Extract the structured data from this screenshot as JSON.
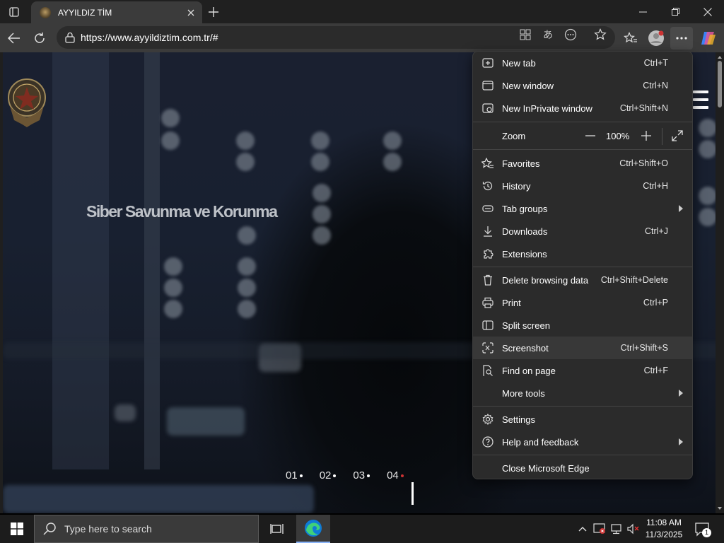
{
  "tab": {
    "title": "AYYILDIZ TİM"
  },
  "address": {
    "url": "https://www.ayyildiztim.com.tr/#"
  },
  "page": {
    "hero_text": "Siber Savunma ve Korunma",
    "slides": [
      "01",
      "02",
      "03",
      "04"
    ],
    "active_slide": "04"
  },
  "menu": {
    "items_top": [
      {
        "label": "New tab",
        "shortcut": "Ctrl+T",
        "icon": "new-tab-icon"
      },
      {
        "label": "New window",
        "shortcut": "Ctrl+N",
        "icon": "new-window-icon"
      },
      {
        "label": "New InPrivate window",
        "shortcut": "Ctrl+Shift+N",
        "icon": "inprivate-icon"
      }
    ],
    "zoom": {
      "label": "Zoom",
      "value": "100%"
    },
    "items_mid": [
      {
        "label": "Favorites",
        "shortcut": "Ctrl+Shift+O",
        "icon": "favorites-icon"
      },
      {
        "label": "History",
        "shortcut": "Ctrl+H",
        "icon": "history-icon"
      },
      {
        "label": "Tab groups",
        "shortcut": "",
        "icon": "tab-groups-icon",
        "submenu": true
      },
      {
        "label": "Downloads",
        "shortcut": "Ctrl+J",
        "icon": "downloads-icon"
      },
      {
        "label": "Extensions",
        "shortcut": "",
        "icon": "extensions-icon"
      }
    ],
    "items_tools": [
      {
        "label": "Delete browsing data",
        "shortcut": "Ctrl+Shift+Delete",
        "icon": "trash-icon"
      },
      {
        "label": "Print",
        "shortcut": "Ctrl+P",
        "icon": "print-icon"
      },
      {
        "label": "Split screen",
        "shortcut": "",
        "icon": "split-screen-icon"
      },
      {
        "label": "Screenshot",
        "shortcut": "Ctrl+Shift+S",
        "icon": "screenshot-icon"
      },
      {
        "label": "Find on page",
        "shortcut": "Ctrl+F",
        "icon": "find-icon"
      },
      {
        "label": "More tools",
        "shortcut": "",
        "icon": "",
        "submenu": true
      }
    ],
    "items_settings": [
      {
        "label": "Settings",
        "shortcut": "",
        "icon": "gear-icon"
      },
      {
        "label": "Help and feedback",
        "shortcut": "",
        "icon": "help-icon",
        "submenu": true
      }
    ],
    "close_label": "Close Microsoft Edge"
  },
  "taskbar": {
    "search_placeholder": "Type here to search",
    "time": "11:08 AM",
    "date": "11/3/2025",
    "notification_count": "1"
  },
  "colors": {
    "accent": "#8ab4f8",
    "menu_bg": "#2b2b2b",
    "active_bullet": "#cc3333"
  }
}
